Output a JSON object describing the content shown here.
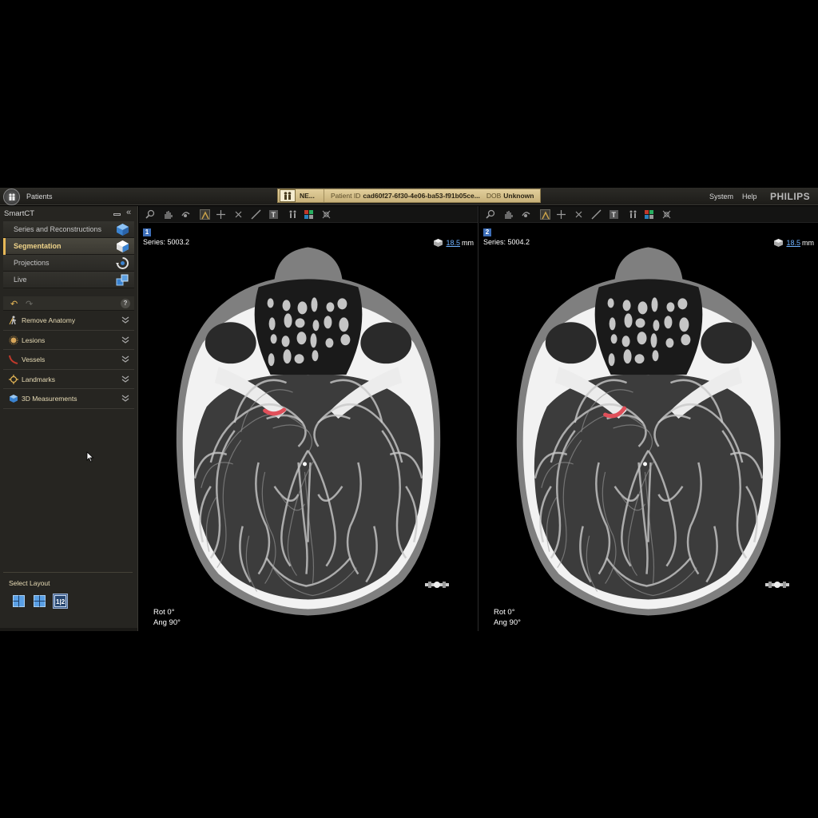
{
  "topbar": {
    "patients_label": "Patients",
    "patient_name": "NE...",
    "patient_id_label": "Patient ID",
    "patient_id": "cad60f27-6f30-4e06-ba53-f91b05ce...",
    "dob_label": "DOB",
    "dob": "Unknown",
    "system_label": "System",
    "help_label": "Help",
    "brand": "PHILIPS"
  },
  "sidebar": {
    "title": "SmartCT",
    "tasks": [
      {
        "label": "Series and Reconstructions",
        "icon": "cube-icon"
      },
      {
        "label": "Segmentation",
        "icon": "segment-cube-icon",
        "active": true
      },
      {
        "label": "Projections",
        "icon": "rotate-icon"
      },
      {
        "label": "Live",
        "icon": "live-cubes-icon"
      }
    ],
    "tools": [
      {
        "label": "Remove Anatomy",
        "icon": "remove-anatomy-icon"
      },
      {
        "label": "Lesions",
        "icon": "lesion-icon"
      },
      {
        "label": "Vessels",
        "icon": "vessel-icon"
      },
      {
        "label": "Landmarks",
        "icon": "landmark-icon"
      },
      {
        "label": "3D Measurements",
        "icon": "measure-3d-icon"
      }
    ],
    "layout_title": "Select Layout",
    "help_glyph": "?"
  },
  "viewports": [
    {
      "number": "1",
      "series": "Series: 5003.2",
      "thickness": "18.5",
      "unit": "mm",
      "rot": "Rot  0°",
      "ang": "Ang  90°"
    },
    {
      "number": "2",
      "series": "Series: 5004.2",
      "thickness": "18.5",
      "unit": "mm",
      "rot": "Rot  0°",
      "ang": "Ang  90°"
    }
  ],
  "colors": {
    "accent": "#e7b857",
    "highlight_vessel": "#e0505a",
    "link_blue": "#6fb2ff"
  }
}
